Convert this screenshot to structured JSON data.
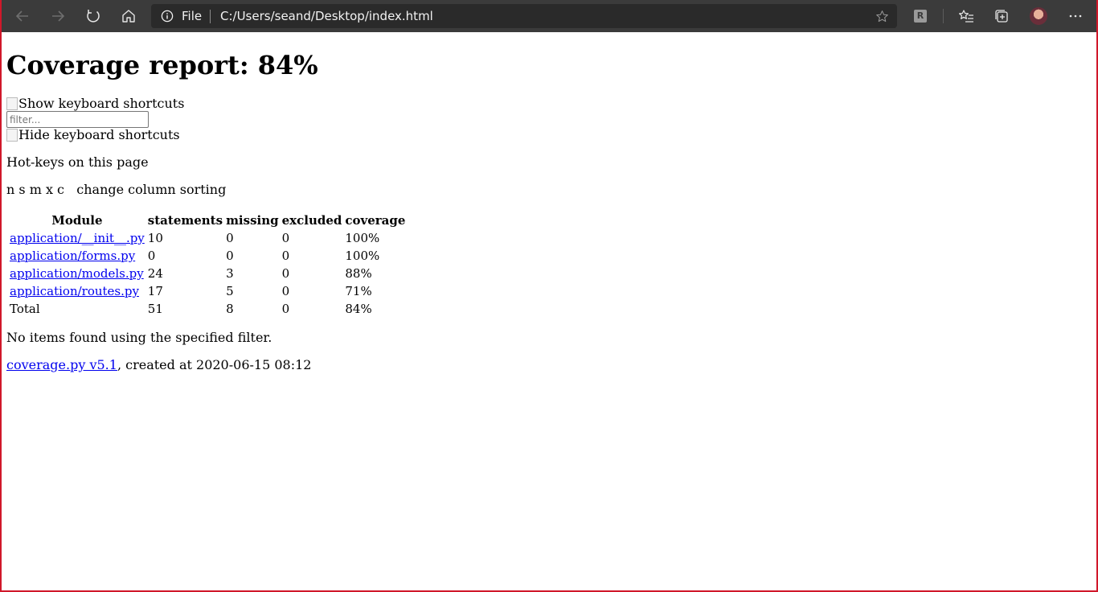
{
  "browser": {
    "address": {
      "scheme": "File",
      "url": "C:/Users/seand/Desktop/index.html"
    },
    "extension_label": "R"
  },
  "page": {
    "title": "Coverage report: 84%",
    "show_shortcuts_alt": "Show keyboard shortcuts",
    "filter_placeholder": "filter...",
    "hide_shortcuts_alt": "Hide keyboard shortcuts",
    "hotkeys_heading": "Hot-keys on this page",
    "hotkeys_line": "n s m x c   change column sorting",
    "table": {
      "headers": [
        "Module",
        "statements",
        "missing",
        "excluded",
        "coverage"
      ],
      "rows": [
        {
          "module": "application/__init__.py",
          "statements": "10",
          "missing": "0",
          "excluded": "0",
          "coverage": "100%"
        },
        {
          "module": "application/forms.py",
          "statements": "0",
          "missing": "0",
          "excluded": "0",
          "coverage": "100%"
        },
        {
          "module": "application/models.py",
          "statements": "24",
          "missing": "3",
          "excluded": "0",
          "coverage": "88%"
        },
        {
          "module": "application/routes.py",
          "statements": "17",
          "missing": "5",
          "excluded": "0",
          "coverage": "71%"
        }
      ],
      "total": {
        "module": "Total",
        "statements": "51",
        "missing": "8",
        "excluded": "0",
        "coverage": "84%"
      }
    },
    "no_items": "No items found using the specified filter.",
    "footer": {
      "link": "coverage.py v5.1",
      "text": ", created at 2020-06-15 08:12"
    }
  }
}
